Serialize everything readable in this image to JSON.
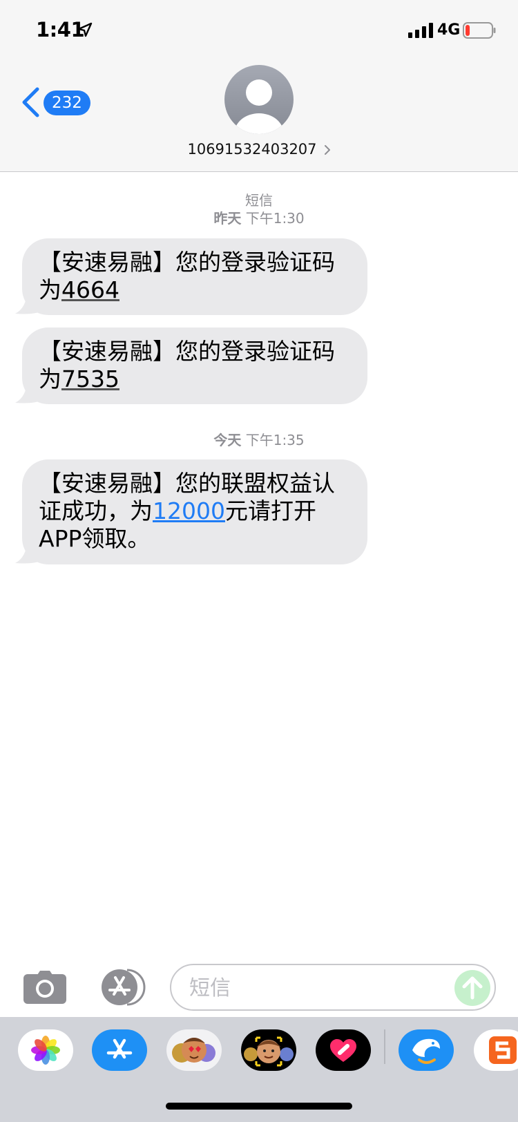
{
  "status_bar": {
    "time": "1:41",
    "network": "4G",
    "battery_level": 0.12,
    "signal_bars": 4
  },
  "header": {
    "back_badge": "232",
    "contact_number": "10691532403207"
  },
  "conversation": {
    "service_label": "短信",
    "groups": [
      {
        "day": "昨天",
        "time": "下午1:30",
        "messages": [
          {
            "text": "【安速易融】您的登录验证码为",
            "code": "4664"
          },
          {
            "text": "【安速易融】您的登录验证码为",
            "code": "7535"
          }
        ]
      },
      {
        "day": "今天",
        "time": "下午1:35",
        "messages": [
          {
            "text_before": "【安速易融】您的联盟权益认证成功，为",
            "amount": "12000",
            "text_after": "元请打开APP领取。"
          }
        ]
      }
    ]
  },
  "input_bar": {
    "placeholder": "短信"
  },
  "app_drawer": {
    "apps": [
      "photos-app",
      "app-store-app",
      "animoji-app",
      "memoji-app",
      "digital-touch-app",
      "ctrip-app",
      "sogou-input-app"
    ]
  },
  "colors": {
    "accent": "#1f7cf5",
    "bubble": "#e9e9eb",
    "header_bg": "#f6f6f6",
    "meta_text": "#8e8e93"
  }
}
